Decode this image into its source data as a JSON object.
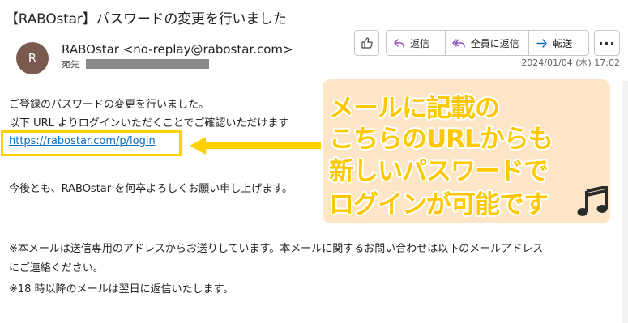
{
  "email": {
    "subject": "【RABOstar】パスワードの変更を行いました",
    "avatar_initial": "R",
    "sender": "RABOstar <no-replay@rabostar.com>",
    "to_label": "宛先",
    "date": "2024/01/04 (木) 17:02"
  },
  "toolbar": {
    "like_icon": "thumbs-up-icon",
    "reply_label": "返信",
    "reply_all_label": "全員に返信",
    "forward_label": "転送",
    "more_label": "..."
  },
  "body": {
    "line1": "ご登録のパスワードの変更を行いました。",
    "line2": "以下 URL よりログインいただくことでご確認いただけます",
    "link": "https://rabostar.com/p/login",
    "line3": "今後とも、RABOstar を何卒よろしくお願い申し上げます。",
    "note1": "※本メールは送信専用のアドレスからお送りしています。本メールに関するお問い合わせは以下のメールアドレス",
    "note2": "にご連絡ください。",
    "note3": "※18 時以降のメールは翌日に返信いたします。"
  },
  "annotation": {
    "line1": "メールに記載の",
    "line2": "こちらのURLからも",
    "line3": "新しいパスワードで",
    "line4": "ログインが可能です",
    "icon": "music-note-icon",
    "highlight_color": "#ffd100",
    "callout_bg": "#fde5c8"
  }
}
